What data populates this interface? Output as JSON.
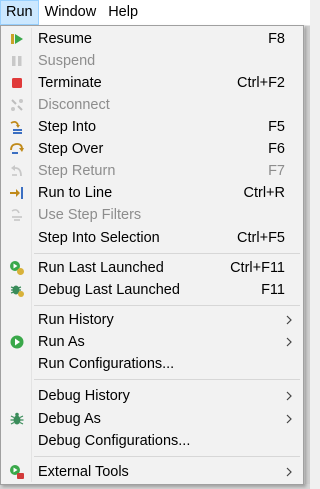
{
  "menubar": {
    "items": [
      {
        "label": "Run"
      },
      {
        "label": "Window"
      },
      {
        "label": "Help"
      }
    ]
  },
  "menu": {
    "items": [
      {
        "label": "Resume",
        "shortcut": "F8",
        "icon": "resume-icon"
      },
      {
        "label": "Suspend",
        "shortcut": "",
        "icon": "suspend-icon"
      },
      {
        "label": "Terminate",
        "shortcut": "Ctrl+F2",
        "icon": "terminate-icon"
      },
      {
        "label": "Disconnect",
        "shortcut": "",
        "icon": "disconnect-icon"
      },
      {
        "label": "Step Into",
        "shortcut": "F5",
        "icon": "step-into-icon"
      },
      {
        "label": "Step Over",
        "shortcut": "F6",
        "icon": "step-over-icon"
      },
      {
        "label": "Step Return",
        "shortcut": "F7",
        "icon": "step-return-icon"
      },
      {
        "label": "Run to Line",
        "shortcut": "Ctrl+R",
        "icon": "run-to-line-icon"
      },
      {
        "label": "Use Step Filters",
        "shortcut": "",
        "icon": "step-filters-icon"
      },
      {
        "label": "Step Into Selection",
        "shortcut": "Ctrl+F5"
      },
      {
        "label": "Run Last Launched",
        "shortcut": "Ctrl+F11",
        "icon": "run-last-icon"
      },
      {
        "label": "Debug Last Launched",
        "shortcut": "F11",
        "icon": "debug-last-icon"
      },
      {
        "label": "Run History"
      },
      {
        "label": "Run As",
        "icon": "run-as-icon"
      },
      {
        "label": "Run Configurations..."
      },
      {
        "label": "Debug History"
      },
      {
        "label": "Debug As",
        "icon": "debug-as-icon"
      },
      {
        "label": "Debug Configurations..."
      },
      {
        "label": "External Tools",
        "icon": "external-tools-icon"
      }
    ]
  }
}
